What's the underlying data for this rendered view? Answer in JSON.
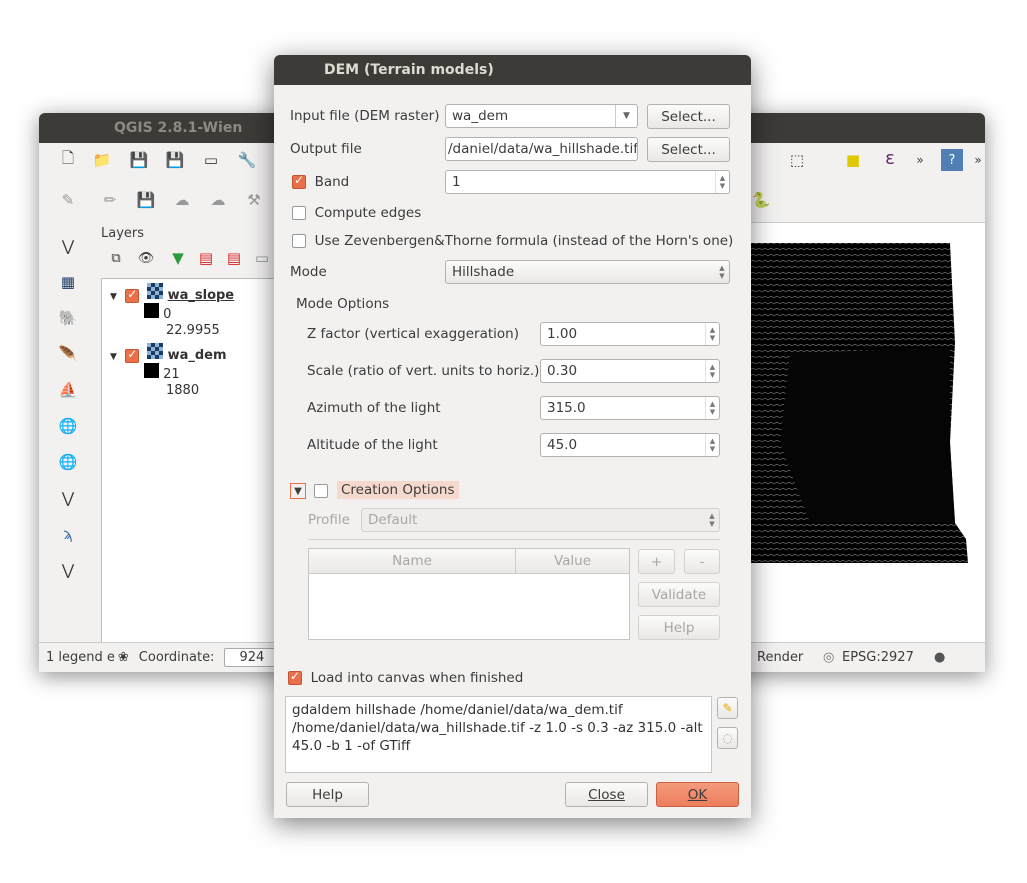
{
  "qgis": {
    "title": "QGIS 2.8.1-Wien",
    "layers_panel_title": "Layers",
    "layers": [
      {
        "name": "wa_slope",
        "checked": true,
        "legend": [
          "0",
          "22.9955"
        ]
      },
      {
        "name": "wa_dem",
        "checked": true,
        "legend": [
          "21",
          "1880"
        ]
      }
    ],
    "status": {
      "legend_text": "1 legend e",
      "coordinate_label": "Coordinate:",
      "coordinate_value": "924",
      "render_label": "Render",
      "crs": "EPSG:2927"
    }
  },
  "dialog": {
    "title": "DEM (Terrain models)",
    "input_label": "Input file (DEM raster)",
    "input_value": "wa_dem",
    "select_label": "Select...",
    "output_label": "Output file",
    "output_value": "/daniel/data/wa_hillshade.tif",
    "band_label": "Band",
    "band_checked": true,
    "band_value": "1",
    "compute_edges_label": "Compute edges",
    "compute_edges_checked": false,
    "zevenbergen_label": "Use Zevenbergen&Thorne formula (instead of the Horn's one)",
    "zevenbergen_checked": false,
    "mode_label": "Mode",
    "mode_value": "Hillshade",
    "mode_options_title": "Mode Options",
    "options": [
      {
        "label": "Z factor (vertical exaggeration)",
        "value": "1.00"
      },
      {
        "label": "Scale (ratio of vert. units to horiz.)",
        "value": "0.30"
      },
      {
        "label": "Azimuth of the light",
        "value": "315.0"
      },
      {
        "label": "Altitude of the light",
        "value": "45.0"
      }
    ],
    "creation_options_label": "Creation Options",
    "creation_options_checked": false,
    "profile_label": "Profile",
    "profile_value": "Default",
    "table_headers": [
      "Name",
      "Value"
    ],
    "plus_label": "+",
    "minus_label": "-",
    "validate_label": "Validate",
    "help_small_label": "Help",
    "load_canvas_label": "Load into canvas when finished",
    "load_canvas_checked": true,
    "command": "gdaldem hillshade /home/daniel/data/wa_dem.tif /home/daniel/data/wa_hillshade.tif -z 1.0 -s 0.3 -az 315.0 -alt 45.0 -b 1 -of GTiff",
    "help_label": "Help",
    "close_label": "Close",
    "ok_label": "OK",
    "accent": "#e9704a"
  }
}
